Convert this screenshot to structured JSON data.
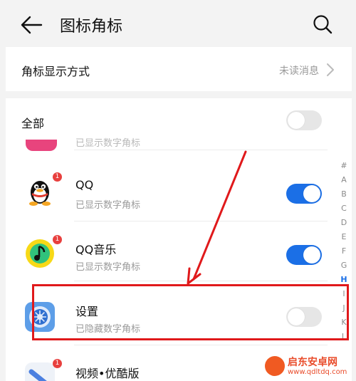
{
  "header": {
    "title": "图标角标"
  },
  "display_mode": {
    "label": "角标显示方式",
    "value": "未读消息"
  },
  "all": {
    "label": "全部",
    "enabled": false
  },
  "peek_row": {
    "subtitle": "已显示数字角标"
  },
  "apps": [
    {
      "name": "QQ",
      "status": "已显示数字角标",
      "badge": "1",
      "enabled": true,
      "icon": "qq-penguin-icon"
    },
    {
      "name": "QQ音乐",
      "status": "已显示数字角标",
      "badge": "1",
      "enabled": true,
      "icon": "qq-music-icon"
    },
    {
      "name": "设置",
      "status": "已隐藏数字角标",
      "badge": "",
      "enabled": false,
      "icon": "settings-gear-icon"
    },
    {
      "name": "视频•优酷版",
      "status": "",
      "badge": "1",
      "enabled": false,
      "icon": "video-app-icon"
    }
  ],
  "alphabet_index": [
    "#",
    "A",
    "B",
    "C",
    "D",
    "E",
    "F",
    "G",
    "H",
    "I",
    "J",
    "K",
    "L"
  ],
  "alphabet_active": "H",
  "watermark": {
    "title": "启东安卓网",
    "url": "www.qdltdq.com"
  },
  "colors": {
    "accent": "#1b6fe6",
    "highlight": "#e0191b",
    "badge": "#e8403e"
  }
}
